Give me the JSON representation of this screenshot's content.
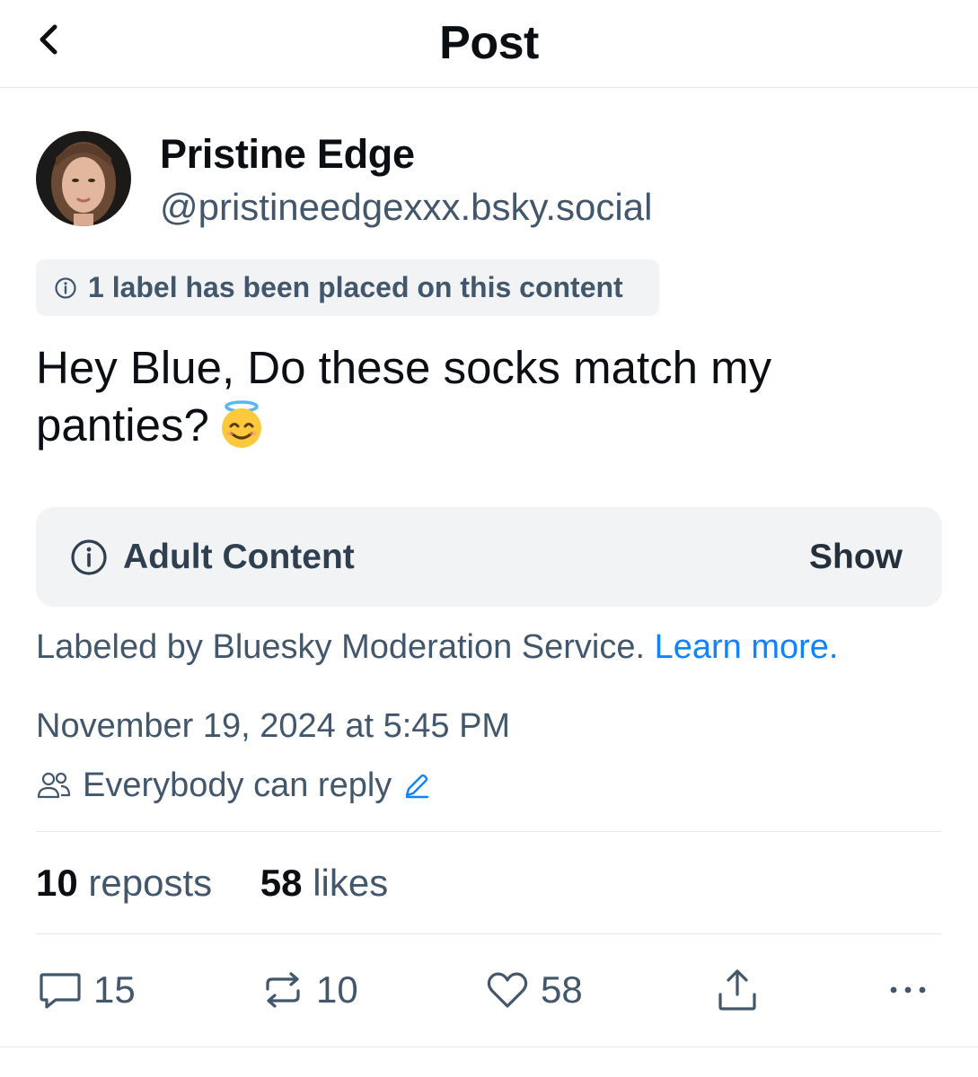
{
  "header": {
    "title": "Post"
  },
  "author": {
    "display_name": "Pristine Edge",
    "handle": "@pristineedgexxx.bsky.social"
  },
  "label_notice": "1 label has been placed on this content",
  "post": {
    "text": "Hey Blue, Do these socks match my panties?",
    "emoji": "smiling-face-with-halo"
  },
  "content_warning": {
    "title": "Adult Content",
    "action": "Show",
    "labeled_by": "Labeled by Bluesky Moderation Service.",
    "learn_more": "Learn more."
  },
  "timestamp": "November 19, 2024 at 5:45 PM",
  "reply_setting": "Everybody can reply",
  "stats": {
    "reposts_count": "10",
    "reposts_label": "reposts",
    "likes_count": "58",
    "likes_label": "likes"
  },
  "actions": {
    "replies": "15",
    "reposts": "10",
    "likes": "58"
  },
  "colors": {
    "link": "#1083fe",
    "muted": "#42576c",
    "surface": "#f1f3f5"
  }
}
